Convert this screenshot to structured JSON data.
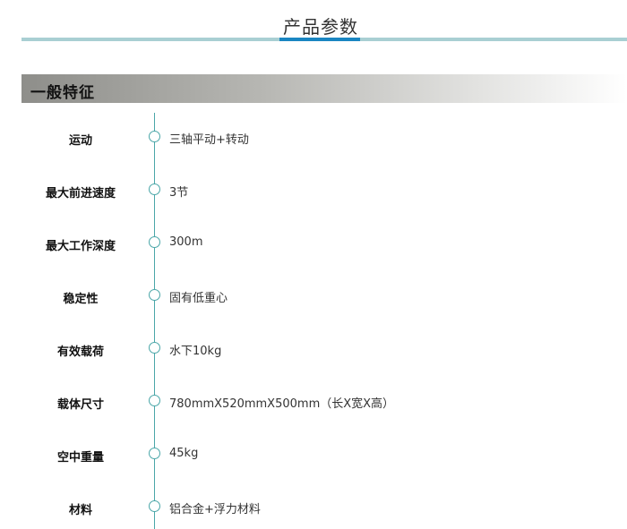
{
  "header": {
    "title": "产品参数"
  },
  "section": {
    "title": "一般特征"
  },
  "specs": [
    {
      "label": "运动",
      "value": "三轴平动+转动"
    },
    {
      "label": "最大前进速度",
      "value": "3节"
    },
    {
      "label": "最大工作深度",
      "value": "300m"
    },
    {
      "label": "稳定性",
      "value": "固有低重心"
    },
    {
      "label": "有效载荷",
      "value": "水下10kg"
    },
    {
      "label": "载体尺寸",
      "value": "780mmX520mmX500mm（长X宽X高）"
    },
    {
      "label": "空中重量",
      "value": "45kg"
    },
    {
      "label": "材料",
      "value": "铝合金+浮力材料"
    }
  ],
  "colors": {
    "header_rule": "#a9cfd3",
    "header_accent": "#1a86c2",
    "timeline": "#4aa6a8"
  }
}
